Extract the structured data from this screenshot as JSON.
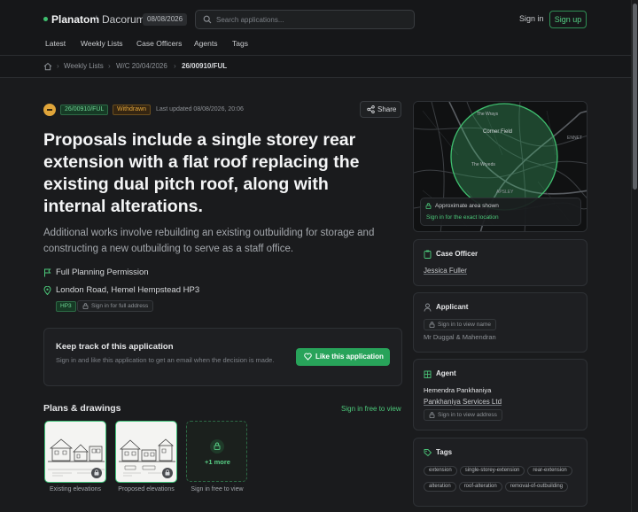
{
  "header": {
    "brand": "Planatom",
    "separator": "/",
    "council": "Dacorum",
    "date_badge": "08/08/2026",
    "search_placeholder": "Search applications...",
    "sign_in": "Sign in",
    "sign_up": "Sign up"
  },
  "nav": {
    "tabs": [
      "Latest",
      "Weekly Lists",
      "Case Officers",
      "Agents",
      "Tags"
    ]
  },
  "breadcrumb": {
    "items": [
      "Weekly Lists",
      "W/C 20/04/2026",
      "26/00910/FUL"
    ]
  },
  "application": {
    "reference": "26/00910/FUL",
    "status": "Withdrawn",
    "last_updated": "Last updated 08/08/2026, 20:06",
    "share_label": "Share",
    "title": "Proposals include a single storey rear extension with a flat roof replacing the existing dual pitch roof, along with internal alterations.",
    "description": "Additional works involve rebuilding an existing outbuilding for storage and constructing a new outbuilding to serve as a staff office.",
    "permission_type": "Full Planning Permission",
    "address": "London Road, Hemel Hempstead HP3",
    "postcode_badge": "HP3",
    "address_lock": "Sign in for full address"
  },
  "track_card": {
    "title": "Keep track of this application",
    "text": "Sign in and like this application to get an email when the decision is made.",
    "button": "Like this application"
  },
  "plans": {
    "title": "Plans & drawings",
    "link": "Sign in free to view",
    "items": [
      {
        "caption": "Existing elevations"
      },
      {
        "caption": "Proposed elevations"
      }
    ],
    "more_label": "+1 more",
    "more_caption": "Sign in free to view"
  },
  "map": {
    "labels": [
      "The Wrays",
      "Corner Field",
      "The Wryeds",
      "APSLEY",
      "ENNET"
    ],
    "note_title": "Approximate area shown",
    "note_link": "Sign in for the exact location",
    "circle_color": "#3fbf6f"
  },
  "case_officer": {
    "heading": "Case Officer",
    "name": "Jessica Fuller"
  },
  "applicant": {
    "heading": "Applicant",
    "lock_label": "Sign in to view name",
    "name": "Mr Duggal & Mahendran"
  },
  "agent": {
    "heading": "Agent",
    "name": "Hemendra Pankhaniya",
    "company": "Pankhaniya Services Ltd",
    "lock_label": "Sign in to view address"
  },
  "tags_card": {
    "heading": "Tags",
    "tags": [
      "extension",
      "single-storey-extension",
      "rear-extension",
      "alteration",
      "roof-alteration",
      "removal-of-outbuilding"
    ]
  },
  "colors": {
    "accent_green": "#28a35a",
    "withdrawn_orange": "#e0a53a",
    "background": "#161719"
  }
}
